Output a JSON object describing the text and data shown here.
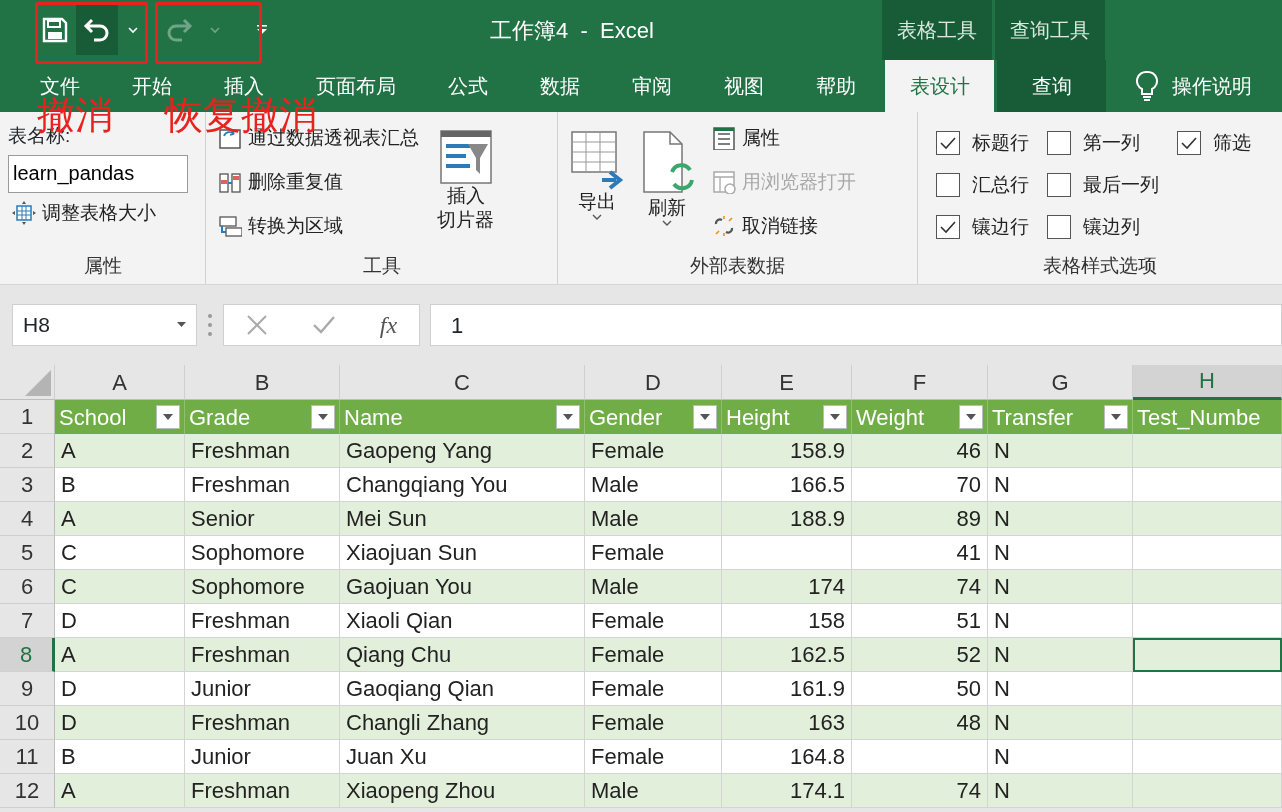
{
  "quick_access": [
    {
      "kind": "save",
      "disabled": false,
      "highlighted": false
    },
    {
      "kind": "undo",
      "disabled": false,
      "highlighted": true
    },
    {
      "kind": "redo",
      "disabled": true,
      "highlighted": false
    },
    {
      "kind": "customize",
      "disabled": false,
      "highlighted": false
    }
  ],
  "window_title": "工作簿4  -  Excel",
  "context_groups": [
    {
      "label": "表格工具"
    },
    {
      "label": "查询工具"
    }
  ],
  "tabs": [
    {
      "label": "文件",
      "selected": false,
      "contextual": false
    },
    {
      "label": "开始",
      "selected": false,
      "contextual": false
    },
    {
      "label": "插入",
      "selected": false,
      "contextual": false
    },
    {
      "label": "页面布局",
      "selected": false,
      "contextual": false
    },
    {
      "label": "公式",
      "selected": false,
      "contextual": false
    },
    {
      "label": "数据",
      "selected": false,
      "contextual": false
    },
    {
      "label": "审阅",
      "selected": false,
      "contextual": false
    },
    {
      "label": "视图",
      "selected": false,
      "contextual": false
    },
    {
      "label": "帮助",
      "selected": false,
      "contextual": false
    },
    {
      "label": "表设计",
      "selected": true,
      "contextual": true
    },
    {
      "label": "查询",
      "selected": false,
      "contextual": true
    }
  ],
  "tell_me": "操作说明",
  "annotations": [
    {
      "label": "撤消"
    },
    {
      "label": "恢复撤消"
    }
  ],
  "ribbon": {
    "groups": [
      {
        "kind": "properties",
        "title": "属性",
        "name_label": "表名称:",
        "name_value": "learn_pandas",
        "resize": "调整表格大小"
      },
      {
        "kind": "tools",
        "title": "工具",
        "items": [
          {
            "label": "通过数据透视表汇总"
          },
          {
            "label": "删除重复值"
          },
          {
            "label": "转换为区域"
          }
        ],
        "big": [
          {
            "lines": [
              "插入",
              "切片器"
            ],
            "dropdown": false
          }
        ]
      },
      {
        "kind": "external",
        "title": "外部表数据",
        "big": [
          {
            "lines": [
              "导出"
            ],
            "dropdown": true
          },
          {
            "lines": [
              "刷新"
            ],
            "dropdown": true
          }
        ],
        "items": [
          {
            "label": "属性",
            "disabled": false
          },
          {
            "label": "用浏览器打开",
            "disabled": true
          },
          {
            "label": "取消链接",
            "disabled": false
          }
        ]
      },
      {
        "kind": "style_options",
        "title": "表格样式选项",
        "checkboxes": [
          {
            "label": "标题行",
            "checked": true
          },
          {
            "label": "汇总行",
            "checked": false
          },
          {
            "label": "镶边行",
            "checked": true
          },
          {
            "label": "第一列",
            "checked": false
          },
          {
            "label": "最后一列",
            "checked": false
          },
          {
            "label": "镶边列",
            "checked": false
          },
          {
            "label": "筛选",
            "checked": true
          }
        ]
      }
    ]
  },
  "formula_bar": {
    "name_box": "H8",
    "function_label": "fx",
    "value": "1"
  },
  "sheet": {
    "columns": [
      {
        "letter": "A",
        "selected": false,
        "kind": "text"
      },
      {
        "letter": "B",
        "selected": false,
        "kind": "text"
      },
      {
        "letter": "C",
        "selected": false,
        "kind": "text"
      },
      {
        "letter": "D",
        "selected": false,
        "kind": "text"
      },
      {
        "letter": "E",
        "selected": false,
        "kind": "number"
      },
      {
        "letter": "F",
        "selected": false,
        "kind": "number"
      },
      {
        "letter": "G",
        "selected": false,
        "kind": "text"
      },
      {
        "letter": "H",
        "selected": true,
        "kind": "text"
      }
    ],
    "header_row": {
      "number": "1",
      "selected": false,
      "cells": [
        {
          "text": "School",
          "filter": true
        },
        {
          "text": "Grade",
          "filter": true
        },
        {
          "text": "Name",
          "filter": true
        },
        {
          "text": "Gender",
          "filter": true
        },
        {
          "text": "Height",
          "filter": true
        },
        {
          "text": "Weight",
          "filter": true
        },
        {
          "text": "Transfer",
          "filter": true
        },
        {
          "text": "Test_Numbe",
          "filter": false
        }
      ]
    },
    "rows": [
      {
        "number": "2",
        "selected": false,
        "cells": [
          "A",
          "Freshman",
          "Gaopeng Yang",
          "Female",
          "158.9",
          "46",
          "N",
          null
        ]
      },
      {
        "number": "3",
        "selected": false,
        "cells": [
          "B",
          "Freshman",
          "Changqiang You",
          "Male",
          "166.5",
          "70",
          "N",
          null
        ]
      },
      {
        "number": "4",
        "selected": false,
        "cells": [
          "A",
          "Senior",
          "Mei Sun",
          "Male",
          "188.9",
          "89",
          "N",
          null
        ]
      },
      {
        "number": "5",
        "selected": false,
        "cells": [
          "C",
          "Sophomore",
          "Xiaojuan Sun",
          "Female",
          null,
          "41",
          "N",
          null
        ]
      },
      {
        "number": "6",
        "selected": false,
        "cells": [
          "C",
          "Sophomore",
          "Gaojuan You",
          "Male",
          "174",
          "74",
          "N",
          null
        ]
      },
      {
        "number": "7",
        "selected": false,
        "cells": [
          "D",
          "Freshman",
          "Xiaoli Qian",
          "Female",
          "158",
          "51",
          "N",
          null
        ]
      },
      {
        "number": "8",
        "selected": true,
        "cells": [
          "A",
          "Freshman",
          "Qiang Chu",
          "Female",
          "162.5",
          "52",
          "N",
          null
        ]
      },
      {
        "number": "9",
        "selected": false,
        "cells": [
          "D",
          "Junior",
          "Gaoqiang Qian",
          "Female",
          "161.9",
          "50",
          "N",
          null
        ]
      },
      {
        "number": "10",
        "selected": false,
        "cells": [
          "D",
          "Freshman",
          "Changli Zhang",
          "Female",
          "163",
          "48",
          "N",
          null
        ]
      },
      {
        "number": "11",
        "selected": false,
        "cells": [
          "B",
          "Junior",
          "Juan Xu",
          "Female",
          "164.8",
          null,
          "N",
          null
        ]
      },
      {
        "number": "12",
        "selected": false,
        "cells": [
          "A",
          "Freshman",
          "Xiaopeng Zhou",
          "Male",
          "174.1",
          "74",
          "N",
          null
        ]
      }
    ]
  }
}
